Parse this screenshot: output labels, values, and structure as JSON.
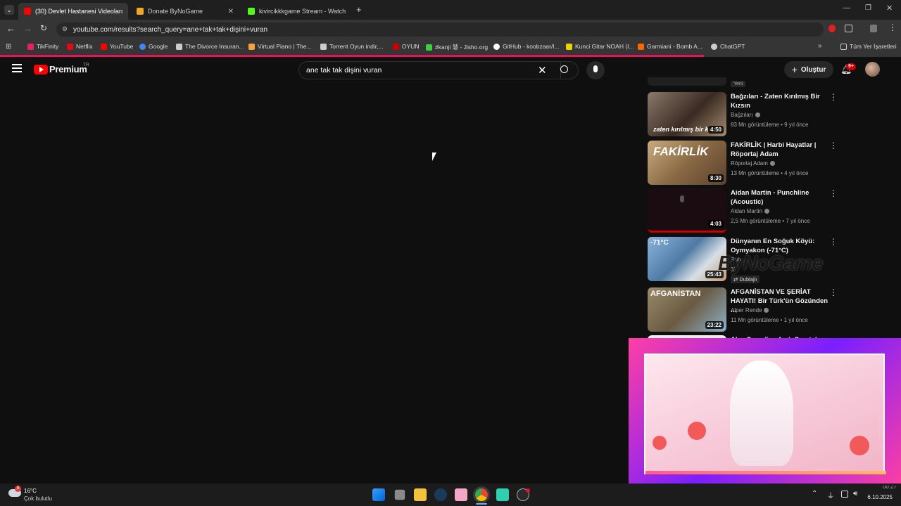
{
  "tabs": [
    {
      "label": "(30) Devlet Hastanesi Videoları",
      "active": true,
      "icon": "youtube-icon",
      "color": "#ff0000"
    },
    {
      "label": "Donate ByNoGame",
      "active": false,
      "icon": "bynogame-icon",
      "color": "#f5a623"
    },
    {
      "label": "kivircikkkgame Stream - Watch",
      "active": false,
      "icon": "kick-icon",
      "color": "#53fc18"
    }
  ],
  "toolbar": {
    "url": "youtube.com/results?search_query=ane+tak+tak+dişini+vuran"
  },
  "bookmarks": [
    {
      "label": "TikFinity",
      "color": "#e91e63"
    },
    {
      "label": "Netflix",
      "color": "#e50914"
    },
    {
      "label": "YouTube",
      "color": "#ff0000"
    },
    {
      "label": "Google",
      "color": "#4285f4"
    },
    {
      "label": "The Divorce Insuran...",
      "color": "#cccccc"
    },
    {
      "label": "Virtual Piano | The...",
      "color": "#f4a23c"
    },
    {
      "label": "Torrent Oyun indir,...",
      "color": "#cccccc"
    },
    {
      "label": "OYUN",
      "color": "#cc0000"
    },
    {
      "label": "#kanji 慧 - Jisho.org",
      "color": "#3ecf3e"
    },
    {
      "label": "GitHub - koobzaar/l...",
      "color": "#ffffff"
    },
    {
      "label": "Kunci Gitar NOAH (I...",
      "color": "#f0d000"
    },
    {
      "label": "Garmiani - Bomb A...",
      "color": "#ff6600"
    },
    {
      "label": "ChatGPT",
      "color": "#cccccc"
    }
  ],
  "all_bookmarks": "Tüm Yer İşaretleri",
  "yt": {
    "logo": "Premium",
    "region": "TR",
    "search_value": "ane tak tak dişini vuran",
    "create": "Oluştur",
    "notif_badge": "9+"
  },
  "partial_top_label": "Yeni",
  "videos": [
    {
      "title": "Bağzıları - Zaten Kırılmış Bir Kızsın",
      "channel": "Bağzıları",
      "meta": "83 Mn görüntüleme • 9 yıl önce",
      "duration": "4:50",
      "thumb_color": "#6e6258",
      "thumb_text": "zaten kırılmış bir kı"
    },
    {
      "title": "FAKİRLİK | Harbi Hayatlar | Röportaj Adam",
      "channel": "Röportaj Adam",
      "meta": "13 Mn görüntüleme • 4 yıl önce",
      "duration": "8:30",
      "thumb_color": "#a0845e",
      "thumb_text": "FAKİRLİK"
    },
    {
      "title": "Aidan Martin - Punchline (Acoustic)",
      "channel": "Aidan Martin",
      "meta": "2,5 Mn görüntüleme • 7 yıl önce",
      "duration": "4:03",
      "thumb_color": "#1a0c10",
      "thumb_text": ""
    },
    {
      "title": "Dünyanın En Soğuk Köyü: Oymyakon (-71°C)",
      "channel": "Ruh",
      "meta": "37",
      "duration": "25:43",
      "thumb_color": "#5a8ab8",
      "thumb_text": "-71°C",
      "badge": "Dublajlı"
    },
    {
      "title": "AFGANİSTAN VE ŞERİAT HAYATI! Bir Türk'ün Gözünden ...",
      "channel": "Alper Rende",
      "meta": "11 Mn görüntüleme • 1 yıl önce",
      "duration": "23:22",
      "thumb_color": "#7a6a52",
      "thumb_text": "AFGANİSTAN"
    }
  ],
  "partial_bottom_title": "Alex Sampling feat. Crystal",
  "watermark": "ByNoGame",
  "taskbar": {
    "temp": "16°C",
    "weather": "Çok bulutlu",
    "date": "6.10.2025",
    "time": "00:27",
    "weather_badge": "8"
  }
}
